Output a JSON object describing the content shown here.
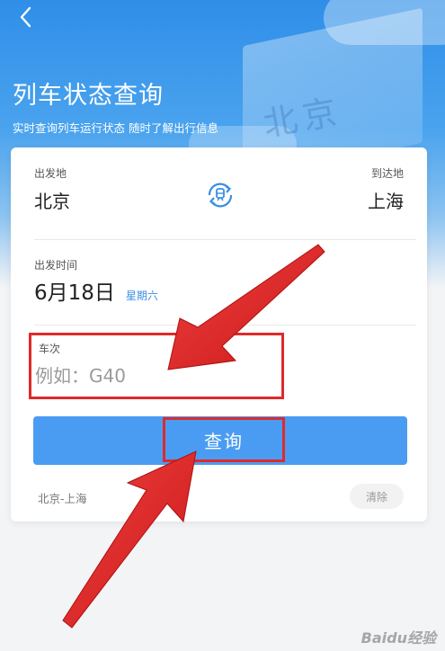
{
  "header": {
    "title": "列车状态查询",
    "subtitle": "实时查询列车运行状态 随时了解出行信息",
    "background_text": "北京"
  },
  "route": {
    "departure_label": "出发地",
    "departure_city": "北京",
    "arrival_label": "到达地",
    "arrival_city": "上海",
    "swap_icon": "swap-arrows-icon"
  },
  "date": {
    "label": "出发时间",
    "value": "6月18日",
    "weekday": "星期六"
  },
  "train": {
    "label": "车次",
    "placeholder": "例如：G40",
    "value": ""
  },
  "actions": {
    "query_label": "查询"
  },
  "history": {
    "items": [
      "北京-上海"
    ],
    "clear_label": "清除"
  },
  "watermark": "Baidu经验",
  "colors": {
    "accent": "#4a9cf2",
    "weekday": "#3a8ee6",
    "highlight": "#e02a2a"
  }
}
